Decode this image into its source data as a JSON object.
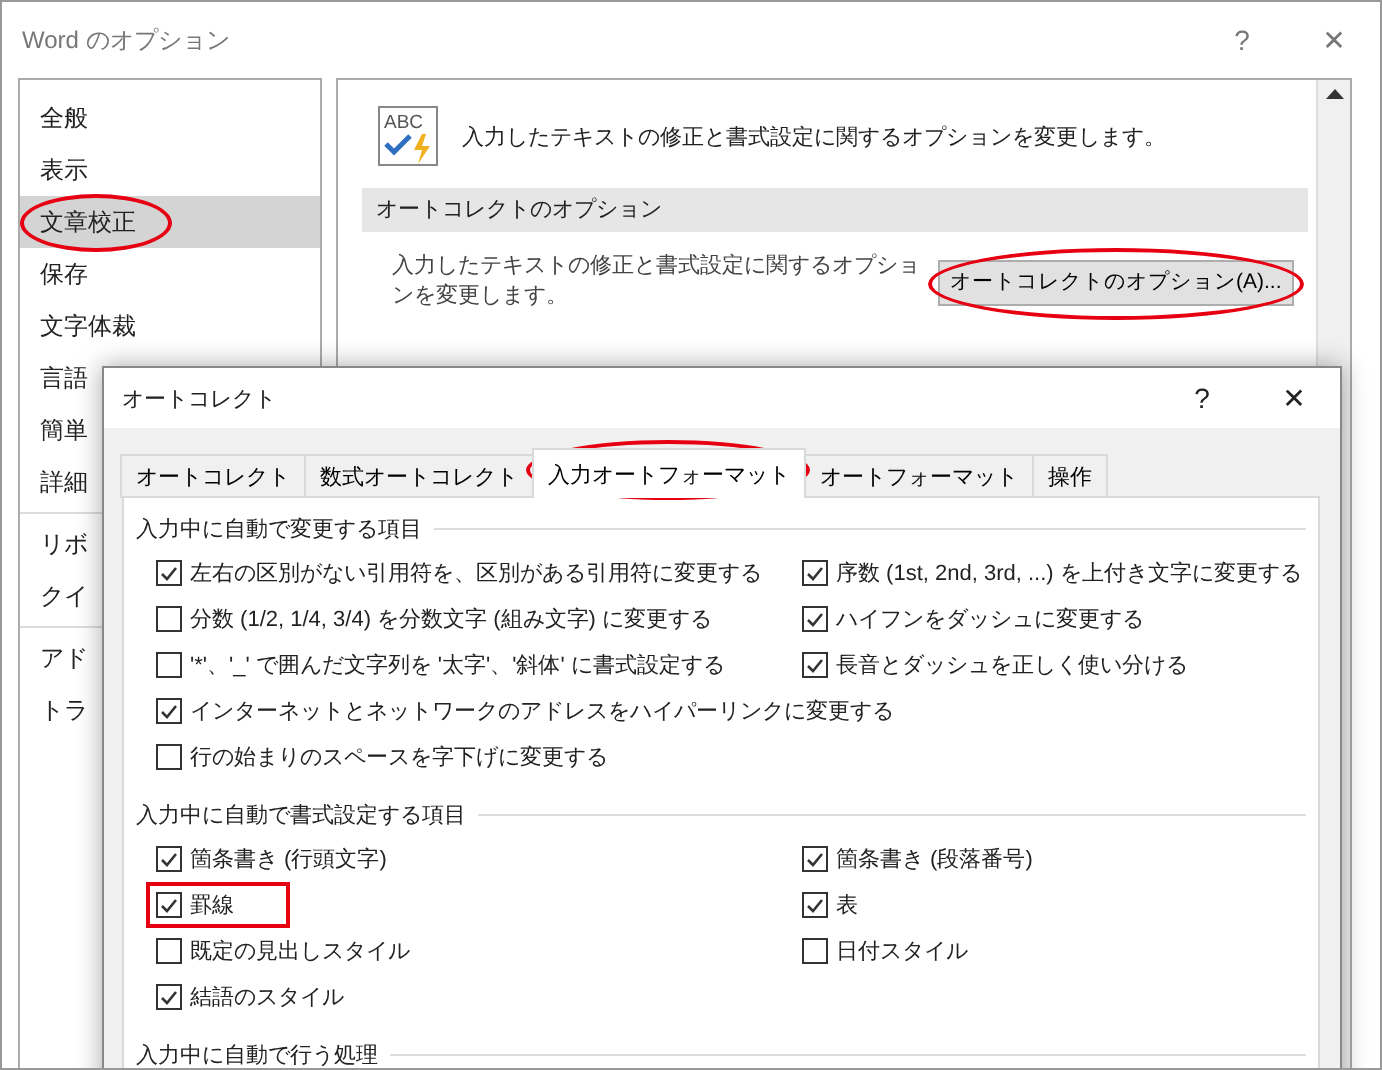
{
  "window": {
    "title": "Word のオプション",
    "help": "?",
    "close": "✕"
  },
  "sidebar": {
    "groups": [
      [
        {
          "label": "全般",
          "selected": false,
          "circled": false
        },
        {
          "label": "表示",
          "selected": false,
          "circled": false
        },
        {
          "label": "文章校正",
          "selected": true,
          "circled": true
        },
        {
          "label": "保存",
          "selected": false,
          "circled": false
        },
        {
          "label": "文字体裁",
          "selected": false,
          "circled": false
        },
        {
          "label": "言語",
          "selected": false,
          "circled": false
        },
        {
          "label": "簡単",
          "selected": false,
          "circled": false
        },
        {
          "label": "詳細",
          "selected": false,
          "circled": false
        }
      ],
      [
        {
          "label": "リボ",
          "selected": false,
          "circled": false
        },
        {
          "label": "クイ",
          "selected": false,
          "circled": false
        }
      ],
      [
        {
          "label": "アド",
          "selected": false,
          "circled": false
        },
        {
          "label": "トラ",
          "selected": false,
          "circled": false
        }
      ]
    ]
  },
  "main": {
    "icon_text": "ABC",
    "intro": "入力したテキストの修正と書式設定に関するオプションを変更します。",
    "section_title": "オートコレクトのオプション",
    "description": "入力したテキストの修正と書式設定に関するオプションを変更します。",
    "button": {
      "label": "オートコレクトのオプション(A)...",
      "circled": true
    }
  },
  "dialog": {
    "title": "オートコレクト",
    "help": "?",
    "close": "✕",
    "tabs": [
      {
        "label": "オートコレクト",
        "selected": false,
        "circled": false
      },
      {
        "label": "数式オートコレクト",
        "selected": false,
        "circled": false
      },
      {
        "label": "入力オートフォーマット",
        "selected": true,
        "circled": true
      },
      {
        "label": "オートフォーマット",
        "selected": false,
        "circled": false
      },
      {
        "label": "操作",
        "selected": false,
        "circled": false
      }
    ],
    "sections": [
      {
        "title": "入力中に自動で変更する項目",
        "left": [
          {
            "label": "左右の区別がない引用符を、区別がある引用符に変更する",
            "checked": true,
            "boxed": false
          },
          {
            "label": "分数 (1/2, 1/4, 3/4) を分数文字 (組み文字) に変更する",
            "checked": false,
            "boxed": false
          },
          {
            "label": "'*'、'_' で囲んだ文字列を '太字'、'斜体' に書式設定する",
            "checked": false,
            "boxed": false
          },
          {
            "label": "インターネットとネットワークのアドレスをハイパーリンクに変更する",
            "checked": true,
            "boxed": false
          },
          {
            "label": "行の始まりのスペースを字下げに変更する",
            "checked": false,
            "boxed": false
          }
        ],
        "right": [
          {
            "label": "序数 (1st, 2nd, 3rd, ...) を上付き文字に変更する",
            "checked": true,
            "boxed": false
          },
          {
            "label": "ハイフンをダッシュに変更する",
            "checked": true,
            "boxed": false
          },
          {
            "label": "長音とダッシュを正しく使い分ける",
            "checked": true,
            "boxed": false
          }
        ]
      },
      {
        "title": "入力中に自動で書式設定する項目",
        "left": [
          {
            "label": "箇条書き (行頭文字)",
            "checked": true,
            "boxed": false
          },
          {
            "label": "罫線",
            "checked": true,
            "boxed": true
          },
          {
            "label": "既定の見出しスタイル",
            "checked": false,
            "boxed": false
          },
          {
            "label": "結語のスタイル",
            "checked": true,
            "boxed": false
          }
        ],
        "right": [
          {
            "label": "箇条書き (段落番号)",
            "checked": true,
            "boxed": false
          },
          {
            "label": "表",
            "checked": true,
            "boxed": false
          },
          {
            "label": "日付スタイル",
            "checked": false,
            "boxed": false
          }
        ]
      },
      {
        "title": "入力中に自動で行う処理"
      }
    ]
  }
}
